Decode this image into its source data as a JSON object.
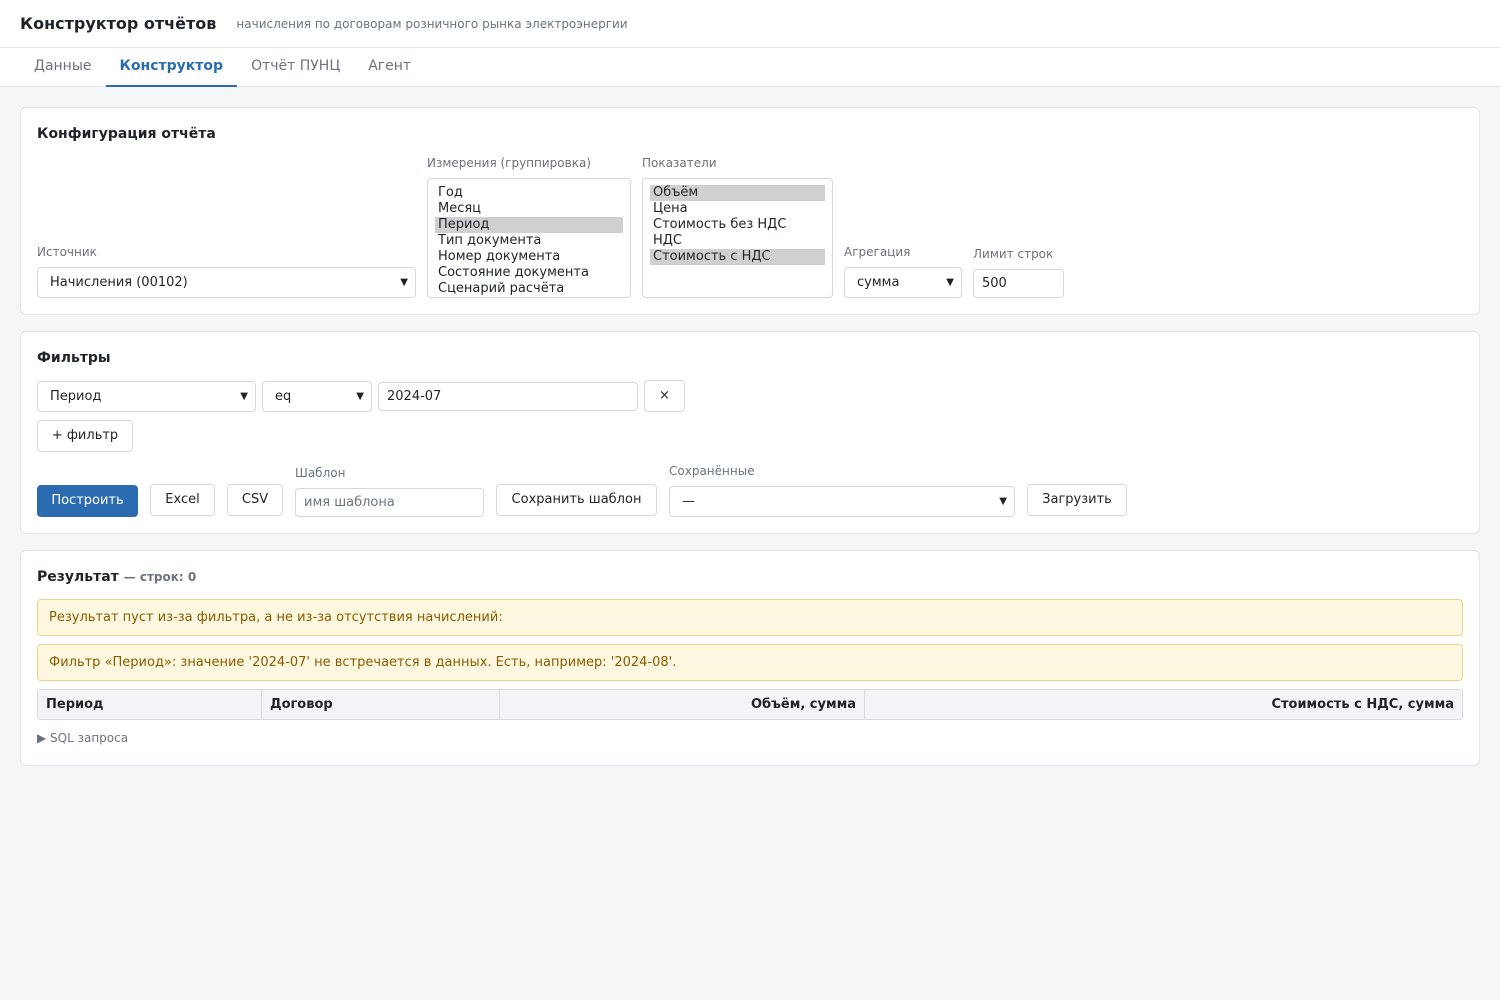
{
  "header": {
    "title": "Конструктор отчётов",
    "subtitle": "начисления по договорам розничного рынка электроэнергии"
  },
  "tabs": [
    {
      "label": "Данные"
    },
    {
      "label": "Конструктор",
      "active": true
    },
    {
      "label": "Отчёт ПУНЦ"
    },
    {
      "label": "Агент"
    }
  ],
  "config": {
    "title": "Конфигурация отчёта",
    "source_label": "Источник",
    "source_value": "Начисления (00102)",
    "dimensions_label": "Измерения (группировка)",
    "dimensions": [
      {
        "label": "Год",
        "selected": false
      },
      {
        "label": "Месяц",
        "selected": false
      },
      {
        "label": "Период",
        "selected": true
      },
      {
        "label": "Тип документа",
        "selected": false
      },
      {
        "label": "Номер документа",
        "selected": false
      },
      {
        "label": "Состояние документа",
        "selected": false
      },
      {
        "label": "Сценарий расчёта",
        "selected": false
      }
    ],
    "measures_label": "Показатели",
    "measures": [
      {
        "label": "Объём",
        "selected": true
      },
      {
        "label": "Цена",
        "selected": false
      },
      {
        "label": "Стоимость без НДС",
        "selected": false
      },
      {
        "label": "НДС",
        "selected": false
      },
      {
        "label": "Стоимость с НДС",
        "selected": true
      }
    ],
    "aggregation_label": "Агрегация",
    "aggregation_value": "сумма",
    "limit_label": "Лимит строк",
    "limit_value": "500"
  },
  "filters": {
    "title": "Фильтры",
    "row": {
      "field": "Период",
      "op": "eq",
      "value": "2024-07",
      "remove_label": "×"
    },
    "add_label": "+ фильтр"
  },
  "actions": {
    "build_label": "Построить",
    "excel_label": "Excel",
    "csv_label": "CSV",
    "template_label": "Шаблон",
    "template_placeholder": "имя шаблона",
    "save_template_label": "Сохранить шаблон",
    "saved_label": "Сохранённые",
    "saved_value": "—",
    "load_label": "Загрузить"
  },
  "result": {
    "title": "Результат",
    "count_text": "— строк: 0",
    "alert1": "Результат пуст из-за фильтра, а не из-за отсутствия начислений:",
    "alert2": "Фильтр «Период»: значение '2024-07' не встречается в данных. Есть, например: '2024-08'.",
    "columns": [
      "Период",
      "Договор",
      "Объём, сумма",
      "Стоимость с НДС, сумма"
    ],
    "sql_toggle": "▶ SQL запроса"
  }
}
